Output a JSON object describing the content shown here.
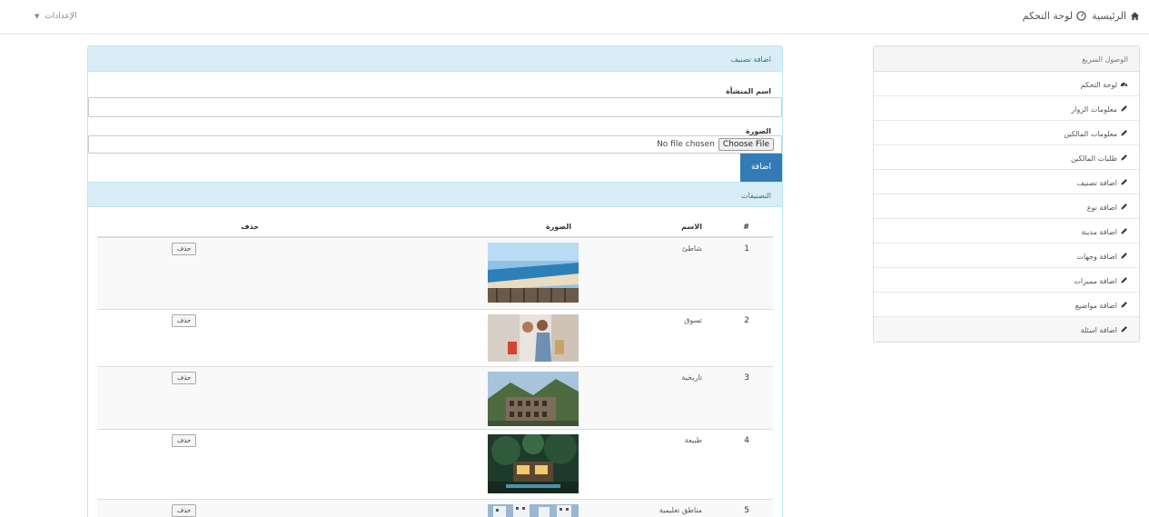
{
  "topbar": {
    "dashboard_label": "لوحة التحكم",
    "home_label": "الرئيسية",
    "settings_label": "الإعدادات"
  },
  "sidebar": {
    "title": "الوصول السريع",
    "items": [
      {
        "label": "لوحة التحكم",
        "icon": "dashboard-icon"
      },
      {
        "label": "معلومات الزوار",
        "icon": "pencil-icon"
      },
      {
        "label": "معلومات المالكين",
        "icon": "pencil-icon"
      },
      {
        "label": "طلبات المالكين",
        "icon": "pencil-icon"
      },
      {
        "label": "اضافة تصنيف",
        "icon": "pencil-icon"
      },
      {
        "label": "اضافة نوع",
        "icon": "pencil-icon"
      },
      {
        "label": "اضافة مدينة",
        "icon": "pencil-icon"
      },
      {
        "label": "اضافة وجهات",
        "icon": "pencil-icon"
      },
      {
        "label": "اضافة مميزات",
        "icon": "pencil-icon"
      },
      {
        "label": "اضافة مواضيع",
        "icon": "pencil-icon"
      },
      {
        "label": "اضافة اسئلة",
        "icon": "pencil-icon"
      }
    ]
  },
  "form": {
    "title": "اضافة تصنيف",
    "name_label": "اسم المنشأة",
    "name_value": "",
    "image_label": "الصورة",
    "no_file_text": "No file chosen",
    "choose_file_label": "Choose File",
    "submit_label": "اضافة"
  },
  "list": {
    "title": "التصنيفات",
    "columns": {
      "num": "#",
      "name": "الاسم",
      "image": "الصورة",
      "delete": "حذف"
    },
    "rows": [
      {
        "num": "1",
        "name": "شاطئ",
        "delete_label": "حذف"
      },
      {
        "num": "2",
        "name": "تسوق",
        "delete_label": "حذف"
      },
      {
        "num": "3",
        "name": "تاريخية",
        "delete_label": "حذف"
      },
      {
        "num": "4",
        "name": "طبيعة",
        "delete_label": "حذف"
      },
      {
        "num": "5",
        "name": "مناطق تعليمية",
        "delete_label": "حذف"
      }
    ]
  },
  "colors": {
    "panel_head_bg": "#d9edf7",
    "panel_border": "#bce8f1",
    "primary_button": "#337ab7"
  }
}
